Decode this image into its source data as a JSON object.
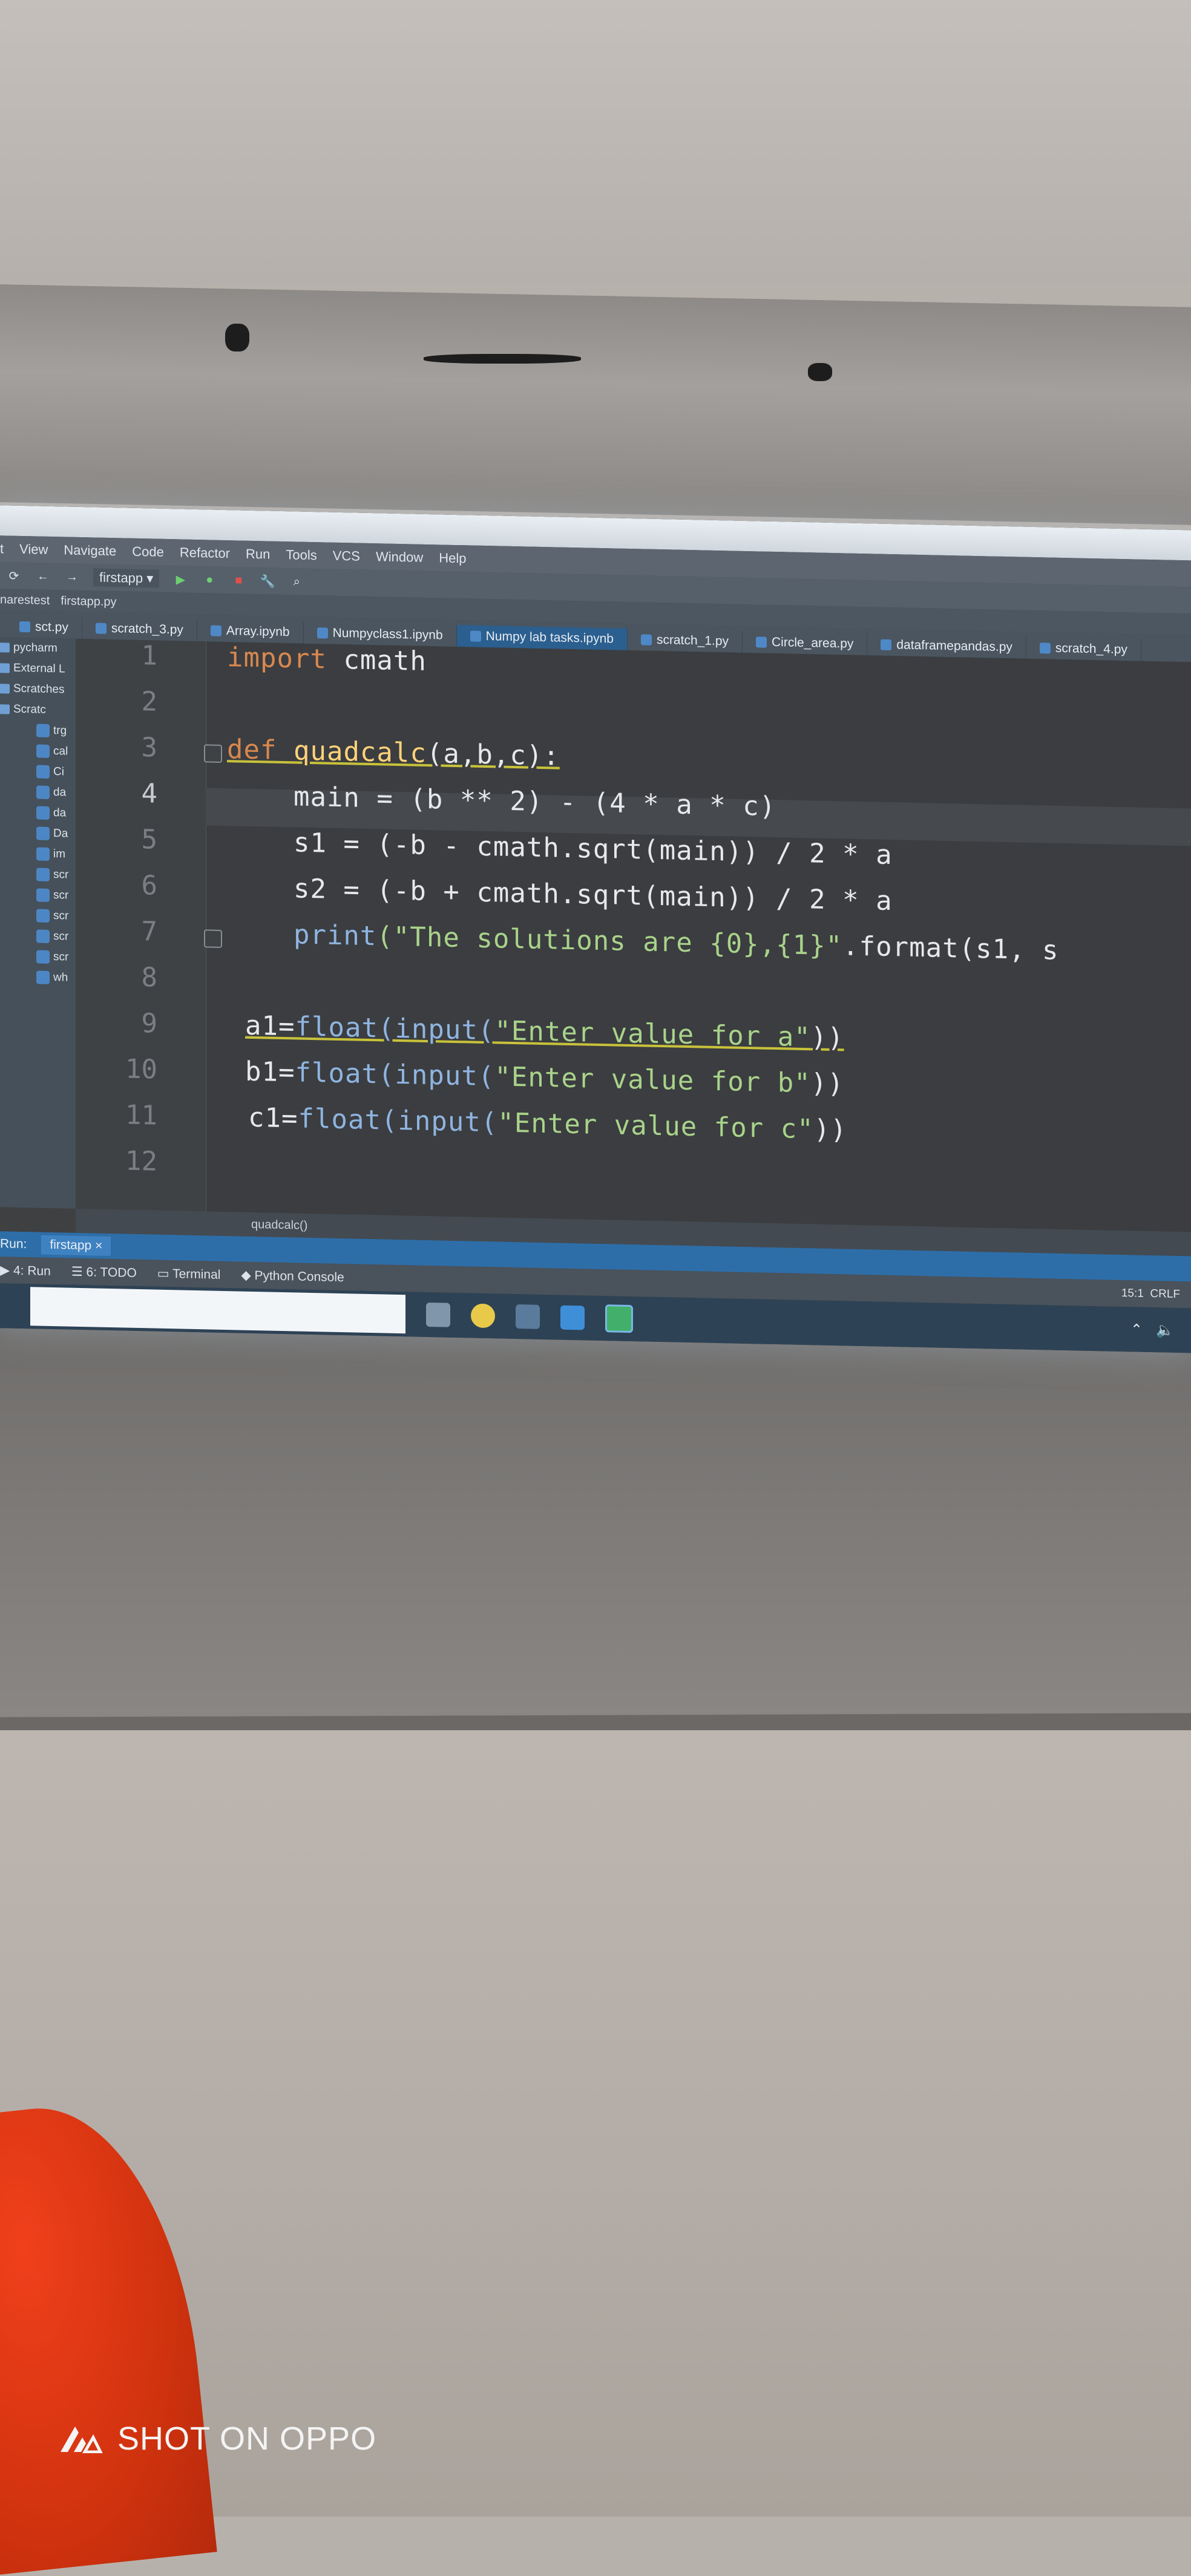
{
  "menu": [
    "t",
    "View",
    "Navigate",
    "Code",
    "Refactor",
    "Run",
    "Tools",
    "VCS",
    "Window",
    "Help"
  ],
  "toolbar": {
    "run_config": "firstapp"
  },
  "breadcrumb": [
    "narestest",
    "firstapp.py"
  ],
  "tabs": [
    "sct.py",
    "scratch_3.py",
    "Array.ipynb",
    "Numpyclass1.ipynb",
    "Numpy lab tasks.ipynb",
    "scratch_1.py",
    "Circle_area.py",
    "dataframepandas.py",
    "scratch_4.py"
  ],
  "active_tab_index": 4,
  "sidebar": {
    "items": [
      "pycharm",
      "External L",
      "Scratches",
      "Scratc"
    ],
    "files": [
      "trg",
      "cal",
      "Ci",
      "da",
      "da",
      "Da",
      "im",
      "scr",
      "scr",
      "scr",
      "scr",
      "scr",
      "wh"
    ]
  },
  "editor": {
    "line_numbers": [
      "1",
      "2",
      "3",
      "4",
      "5",
      "6",
      "7",
      "8",
      "9",
      "10",
      "11",
      "12"
    ],
    "current_line": "4",
    "code": {
      "l1_kw": "import",
      "l1_rest": " cmath",
      "l3_kw": "def",
      "l3_fn": " quadcalc",
      "l3_rest": "(a,b,c):",
      "l4": "    main = (b ** 2) - (4 * a * c)",
      "l5": "    s1 = (-b - cmath.sqrt(main)) / 2 * a",
      "l6": "    s2 = (-b + cmath.sqrt(main)) / 2 * a",
      "l7_bi": "    print",
      "l7_str": "(\"The solutions are {0},{1}\"",
      "l7_rest": ".format(s1, s",
      "l9_var": "a1=",
      "l9_bi": "float(input(",
      "l9_str": "\"Enter value for a\"",
      "l9_end": "))",
      "l10_var": "b1=",
      "l10_bi": "float(input(",
      "l10_str": "\"Enter value for b\"",
      "l10_end": "))",
      "l11_var": "c1=",
      "l11_bi": "float(input(",
      "l11_str": "\"Enter value for c\"",
      "l11_end": "))"
    }
  },
  "structure": "quadcalc()",
  "run_bar": {
    "label": "Run:",
    "tab": "firstapp"
  },
  "tool_windows": [
    "4: Run",
    "6: TODO",
    "Terminal",
    "Python Console"
  ],
  "status": {
    "position": "15:1",
    "line_sep": "CRLF"
  },
  "watermark": "SHOT ON OPPO",
  "colors": {
    "accent": "#2e6ea8",
    "red_object": "#e03a15"
  }
}
